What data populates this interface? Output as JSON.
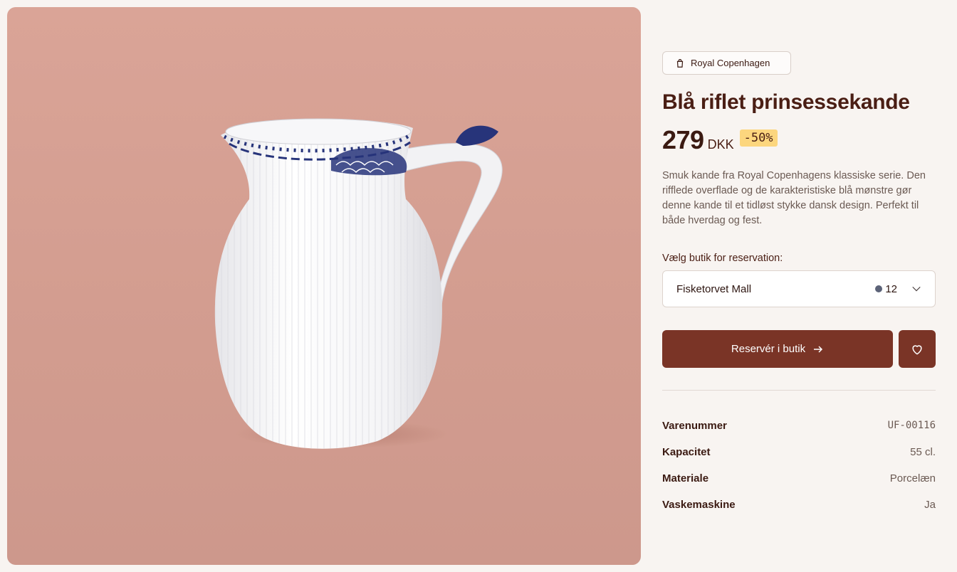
{
  "product": {
    "brand": "Royal Copenhagen",
    "title": "Blå riflet prinsessekande",
    "price": "279",
    "currency": "DKK",
    "discount": "-50%",
    "description": "Smuk kande fra Royal Copenhagens klassiske serie. Den rifflede overflade og de karakteristiske blå mønstre gør denne kande til et tidløst stykke dansk design. Perfekt til både hverdag og fest."
  },
  "store": {
    "label": "Vælg butik for reservation:",
    "selected": "Fisketorvet Mall",
    "stock": "12"
  },
  "actions": {
    "reserve_label": "Reservér i butik"
  },
  "specs": [
    {
      "key": "Varenummer",
      "value": "UF-00116"
    },
    {
      "key": "Kapacitet",
      "value": "55 cl."
    },
    {
      "key": "Materiale",
      "value": "Porcelæn"
    },
    {
      "key": "Vaskemaskine",
      "value": "Ja"
    }
  ],
  "colors": {
    "accent": "#7a3426",
    "badge": "#fcd67e",
    "image_bg": "#d6a093",
    "pattern_blue": "#27347a"
  },
  "icons": {
    "brand": "shopping-bag-icon",
    "dropdown": "chevron-down-icon",
    "reserve": "arrow-right-icon",
    "favorite": "heart-icon"
  }
}
